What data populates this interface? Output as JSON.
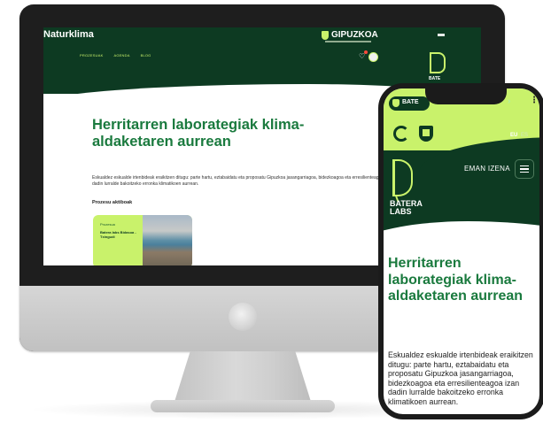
{
  "desktop": {
    "brand": "Naturklima",
    "partner": "GIPUZKOA",
    "nav": [
      "PROZESUAK",
      "AGENDA",
      "BLOG"
    ],
    "title": "Herritarren laborategiak klima-aldaketaren aurrean",
    "description": "Eskualdez eskualde irtenbideak eraikitzen ditugu: parte hartu, eztabaidatu eta proposatu Gipuzkoa jasangarriagoa, bidezkoagoa eta erresilienteagoa izan dadin lurralde bakoitzeko erronka klimatikoen aurrean.",
    "projects_label": "Prozesu aktiboak",
    "card": {
      "tag": "Prozesua",
      "title": "Batera labs Bidasoa - Txingudi"
    },
    "batera_label": "BATE"
  },
  "mobile": {
    "pill_label": "BATE",
    "lang_active": "EU",
    "lang_other": "ES",
    "logo_text": "BATERA LABS",
    "cta": "EMAN IZENA",
    "title": "Herritarren laborategiak klima-aldaketaren aurrean",
    "description": "Eskualdez eskualde irtenbideak eraikitzen ditugu: parte hartu, eztabaidatu eta proposatu Gipuzkoa jasangarriagoa, bidezkoagoa eta erresilienteagoa izan dadin lurralde bakoitzeko erronka klimatikoen aurrean."
  },
  "colors": {
    "dark_green": "#0d3a22",
    "lime": "#c9f26b",
    "title_green": "#1a7a3e"
  }
}
